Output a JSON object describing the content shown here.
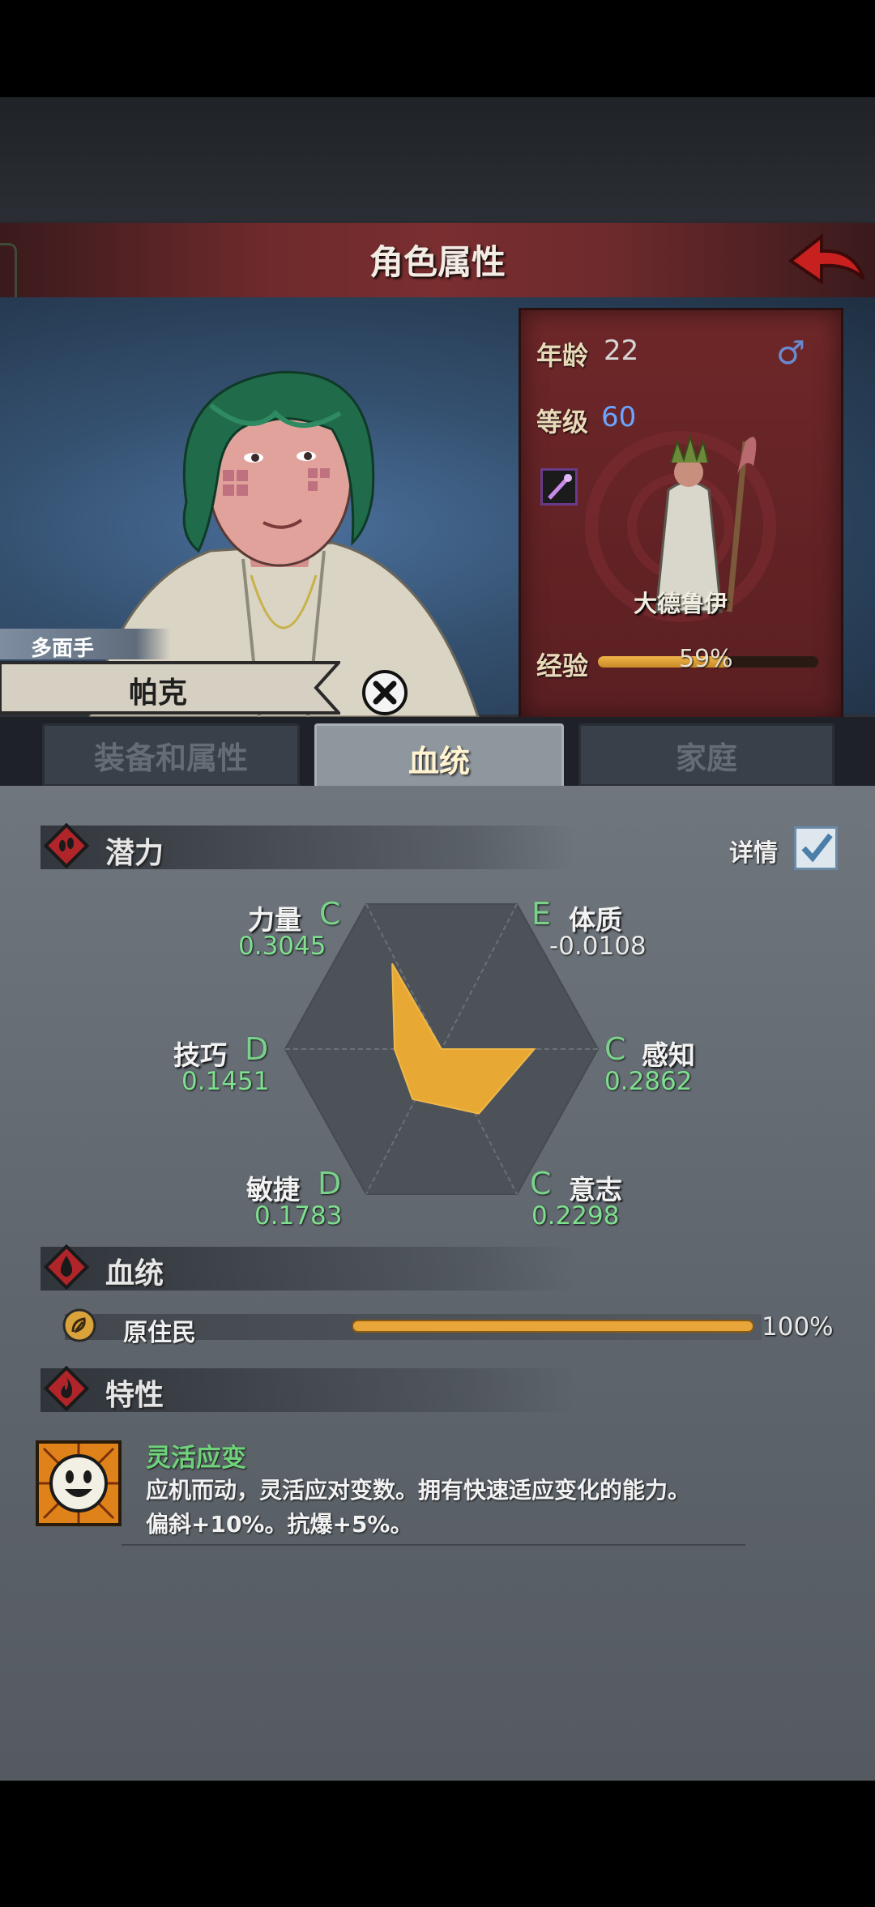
{
  "header": {
    "title": "角色属性"
  },
  "character": {
    "class_label": "多面手",
    "name": "帕克"
  },
  "info": {
    "age_label": "年龄",
    "age": "22",
    "level_label": "等级",
    "level": "60",
    "gender_icon": "♂",
    "class_name": "大德鲁伊",
    "exp_label": "经验",
    "exp_percent": "59%",
    "exp_fraction": 0.59
  },
  "tabs": [
    {
      "label": "装备和属性",
      "active": false
    },
    {
      "label": "血统",
      "active": true
    },
    {
      "label": "家庭",
      "active": false
    }
  ],
  "potential": {
    "title": "潜力",
    "details_label": "详情",
    "details_checked": true,
    "stats": {
      "strength": {
        "name": "力量",
        "grade": "C",
        "value": "0.3045"
      },
      "constitution": {
        "name": "体质",
        "grade": "E",
        "value": "-0.0108"
      },
      "skill": {
        "name": "技巧",
        "grade": "D",
        "value": "0.1451"
      },
      "perception": {
        "name": "感知",
        "grade": "C",
        "value": "0.2862"
      },
      "agility": {
        "name": "敏捷",
        "grade": "D",
        "value": "0.1783"
      },
      "will": {
        "name": "意志",
        "grade": "C",
        "value": "0.2298"
      }
    }
  },
  "bloodline": {
    "title": "血统",
    "entries": [
      {
        "name": "原住民",
        "percent": "100%",
        "fraction": 1.0
      }
    ]
  },
  "traits": {
    "title": "特性",
    "items": [
      {
        "name": "灵活应变",
        "desc_line1": "应机而动，灵活应对变数。拥有快速适应变化的能力。",
        "desc_line2": "偏斜+10%。抗爆+5%。"
      }
    ]
  },
  "colors": {
    "accent_red": "#8b2a2c",
    "grade_green": "#79d18a",
    "radar_fill": "#e7a934",
    "exp_fill": "#e8a53a"
  }
}
